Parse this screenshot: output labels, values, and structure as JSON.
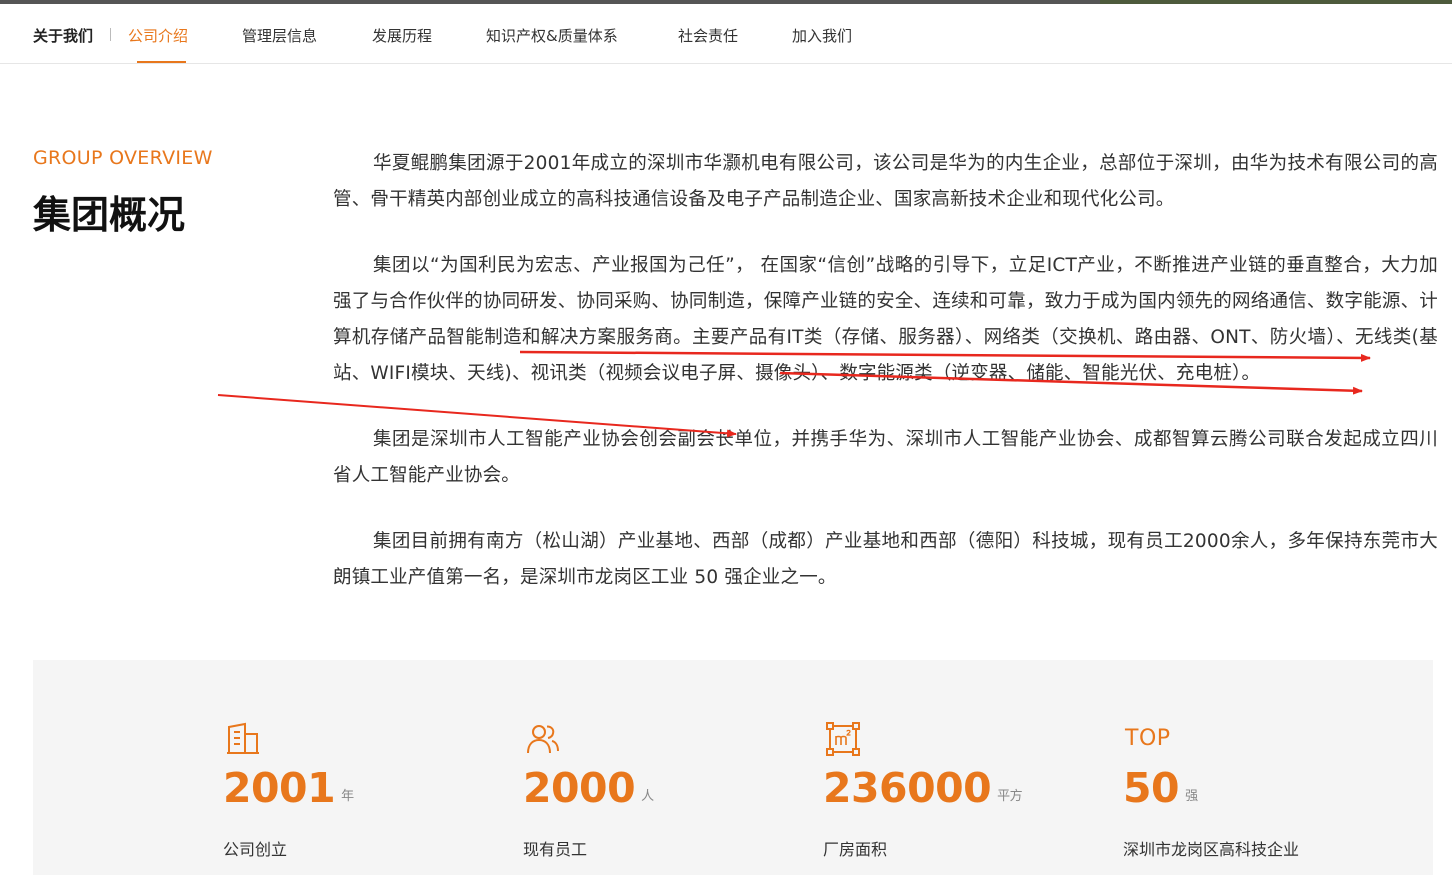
{
  "nav": {
    "title": "关于我们",
    "items": [
      {
        "label": "公司介绍",
        "active": true
      },
      {
        "label": "管理层信息",
        "active": false
      },
      {
        "label": "发展历程",
        "active": false
      },
      {
        "label": "知识产权&质量体系",
        "active": false
      },
      {
        "label": "社会责任",
        "active": false
      },
      {
        "label": "加入我们",
        "active": false
      }
    ]
  },
  "overview": {
    "en_title": "GROUP OVERVIEW",
    "zh_title": "集团概况",
    "paragraphs": [
      "华夏鲲鹏集团源于2001年成立的深圳市华灏机电有限公司，该公司是华为的内生企业，总部位于深圳，由华为技术有限公司的高管、骨干精英内部创业成立的高科技通信设备及电子产品制造企业、国家高新技术企业和现代化公司。",
      "集团以“为国利民为宏志、产业报国为己任”， 在国家“信创”战略的引导下，立足ICT产业，不断推进产业链的垂直整合，大力加强了与合作伙伴的协同研发、协同采购、协同制造，保障产业链的安全、连续和可靠，致力于成为国内领先的网络通信、数字能源、计算机存储产品智能制造和解决方案服务商。主要产品有IT类（存储、服务器）、网络类（交换机、路由器、ONT、防火墙）、无线类(基站、WIFI模块、天线)、视讯类（视频会议电子屏、摄像头）、数字能源类（逆变器、储能、智能光伏、充电桩）。",
      "集团是深圳市人工智能产业协会创会副会长单位，并携手华为、深圳市人工智能产业协会、成都智算云腾公司联合发起成立四川省人工智能产业协会。",
      "集团目前拥有南方（松山湖）产业基地、西部（成都）产业基地和西部（德阳）科技城，现有员工2000余人，多年保持东莞市大朗镇工业产值第一名，是深圳市龙岗区工业 50 强企业之一。"
    ]
  },
  "stats": [
    {
      "icon": "building-icon",
      "value": "2001",
      "unit": "年",
      "label": "公司创立"
    },
    {
      "icon": "people-icon",
      "value": "2000",
      "unit": "人",
      "label": "现有员工"
    },
    {
      "icon": "area-m2-icon",
      "value": "236000",
      "unit": "平方",
      "label": "厂房面积"
    },
    {
      "top_text": "TOP",
      "value": "50",
      "unit": "强",
      "label": "深圳市龙岗区高科技企业"
    }
  ],
  "colors": {
    "accent": "#e8771c",
    "annotation_red": "#e8281e",
    "panel_bg": "#f5f5f5"
  }
}
